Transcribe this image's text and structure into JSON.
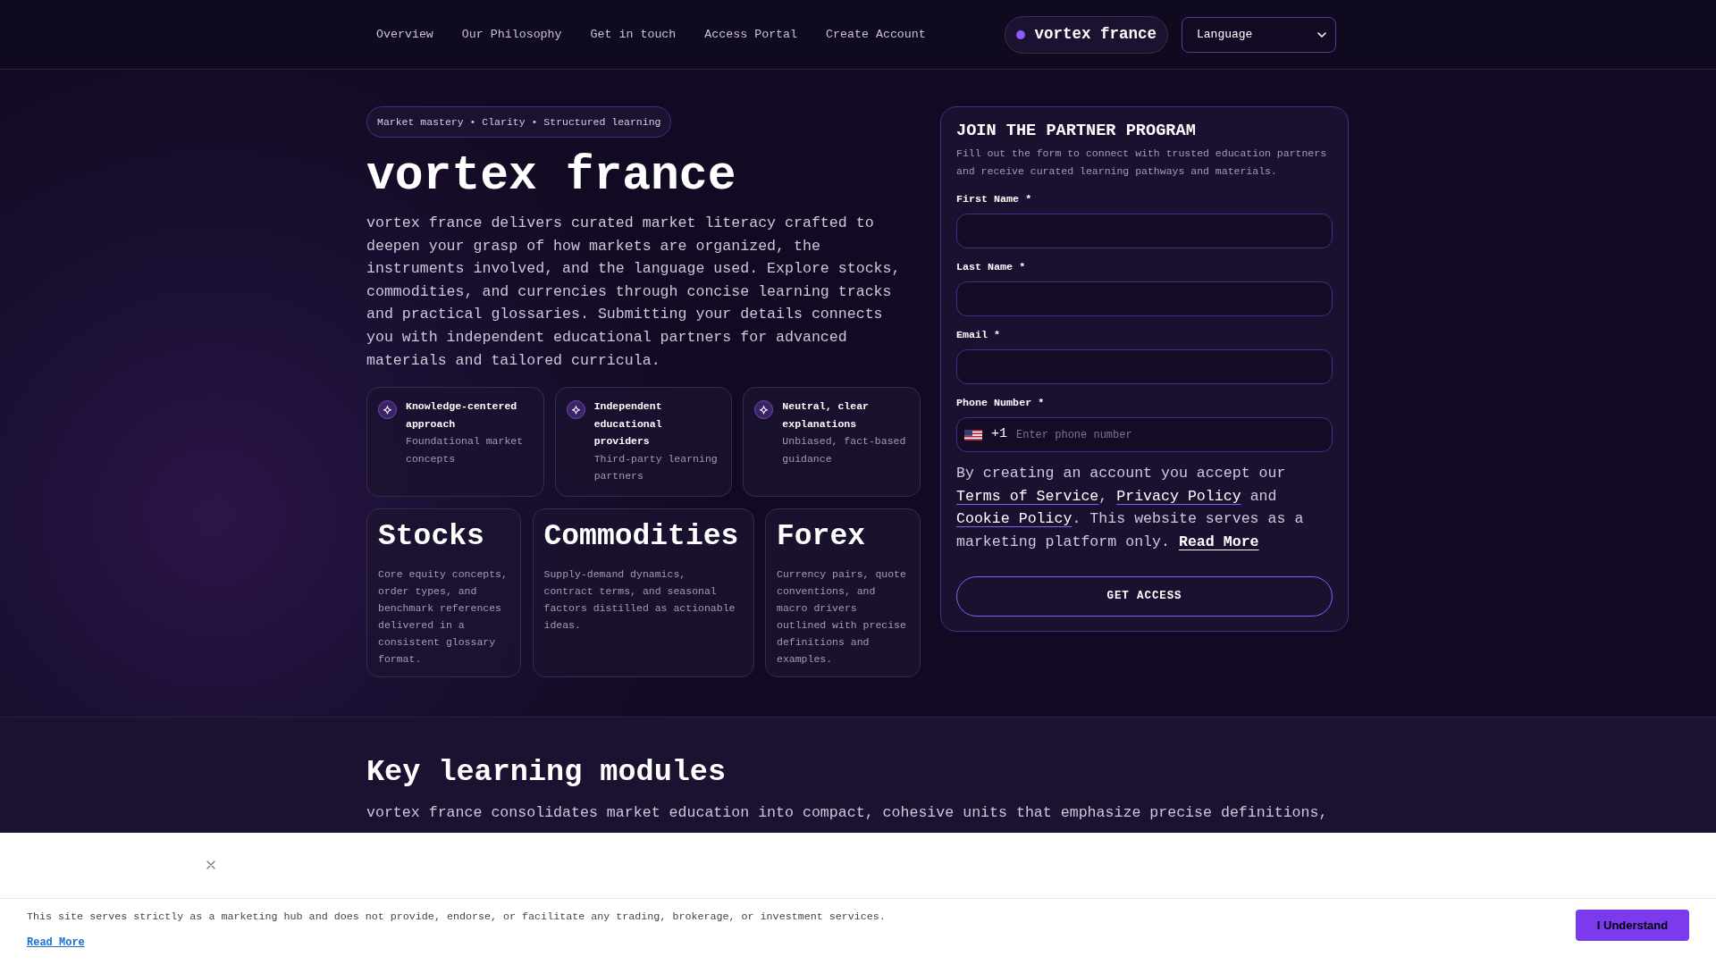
{
  "nav": {
    "links": [
      {
        "label": "Overview"
      },
      {
        "label": "Our Philosophy"
      },
      {
        "label": "Get in touch"
      },
      {
        "label": "Access Portal"
      },
      {
        "label": "Create Account"
      }
    ],
    "brand": "vortex france",
    "language_select": "Language"
  },
  "hero": {
    "tagline": "Market mastery • Clarity • Structured learning",
    "title": "vortex france",
    "description": "vortex france delivers curated market literacy crafted to deepen your grasp of how markets are organized, the instruments involved, and the language used. Explore stocks, commodities, and currencies through concise learning tracks and practical glossaries. Submitting your details connects you with independent educational partners for advanced materials and tailored curricula.",
    "features": [
      {
        "title": "Knowledge-centered approach",
        "description": "Foundational market concepts"
      },
      {
        "title": "Independent educational providers",
        "description": "Third-party learning partners"
      },
      {
        "title": "Neutral, clear explanations",
        "description": "Unbiased, fact-based guidance"
      }
    ],
    "topics": [
      {
        "title": "Stocks",
        "description": "Core equity concepts, order types, and benchmark references delivered in a consistent glossary format."
      },
      {
        "title": "Commodities",
        "description": "Supply-demand dynamics, contract terms, and seasonal factors distilled as actionable ideas."
      },
      {
        "title": "Forex",
        "description": "Currency pairs, quote conventions, and macro drivers outlined with precise definitions and examples."
      }
    ]
  },
  "signup_form": {
    "title": "JOIN THE PARTNER PROGRAM",
    "subtitle": "Fill out the form to connect with trusted education partners and receive curated learning pathways and materials.",
    "fields": [
      {
        "kind": "text",
        "label": "First Name *"
      },
      {
        "kind": "text",
        "label": "Last Name *"
      },
      {
        "kind": "email",
        "label": "Email *"
      },
      {
        "kind": "phone",
        "label": "Phone Number *",
        "dial_code": "+1",
        "placeholder": "Enter phone number"
      }
    ],
    "consent": [
      {
        "kind": "text",
        "text": "By creating an account you accept our "
      },
      {
        "kind": "link",
        "text": "Terms of Service"
      },
      {
        "kind": "text",
        "text": ", "
      },
      {
        "kind": "link",
        "text": "Privacy Policy"
      },
      {
        "kind": "text",
        "text": " and "
      },
      {
        "kind": "link",
        "text": "Cookie Policy"
      },
      {
        "kind": "text",
        "text": ". This website serves as a marketing platform only. "
      },
      {
        "kind": "strong_link",
        "text": "Read More"
      }
    ],
    "submit": "GET ACCESS"
  },
  "modules": {
    "title": "Key learning modules",
    "description": "vortex france consolidates market education into compact, cohesive units that emphasize precise definitions,"
  },
  "cookie_banner": {
    "message": "This site serves strictly as a marketing hub and does not provide, endorse, or facilitate any trading, brokerage, or investment services.",
    "link": "Read More",
    "button": "I Understand"
  }
}
